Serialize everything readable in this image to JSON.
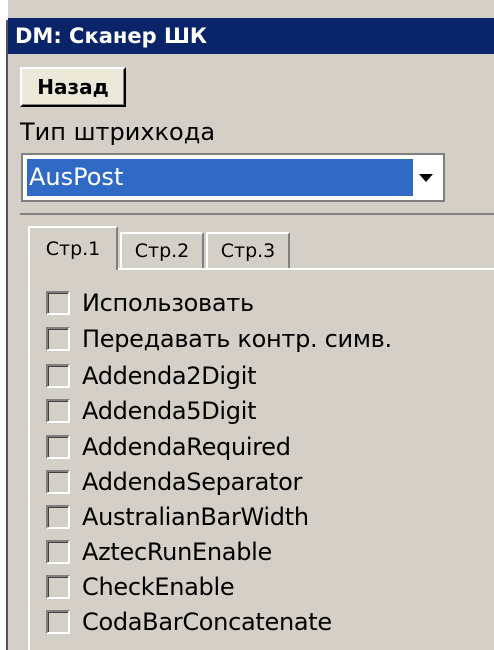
{
  "window": {
    "title": "DM: Сканер ШК"
  },
  "toolbar": {
    "back_label": "Назад"
  },
  "barcode_type": {
    "label": "Тип штрихкода",
    "selected": "AusPost"
  },
  "tabs": [
    {
      "label": "Стр.1",
      "active": true
    },
    {
      "label": "Стр.2",
      "active": false
    },
    {
      "label": "Стр.3",
      "active": false
    }
  ],
  "options": [
    {
      "label": "Использовать",
      "checked": false
    },
    {
      "label": "Передавать контр. симв.",
      "checked": false
    },
    {
      "label": "Addenda2Digit",
      "checked": false
    },
    {
      "label": "Addenda5Digit",
      "checked": false
    },
    {
      "label": "AddendaRequired",
      "checked": false
    },
    {
      "label": "AddendaSeparator",
      "checked": false
    },
    {
      "label": "AustralianBarWidth",
      "checked": false
    },
    {
      "label": "AztecRunEnable",
      "checked": false
    },
    {
      "label": "CheckEnable",
      "checked": false
    },
    {
      "label": "CodaBarConcatenate",
      "checked": false
    }
  ],
  "colors": {
    "title_bg": "#0a246a",
    "selection_bg": "#316ac5",
    "window_bg": "#d4d0c8"
  }
}
